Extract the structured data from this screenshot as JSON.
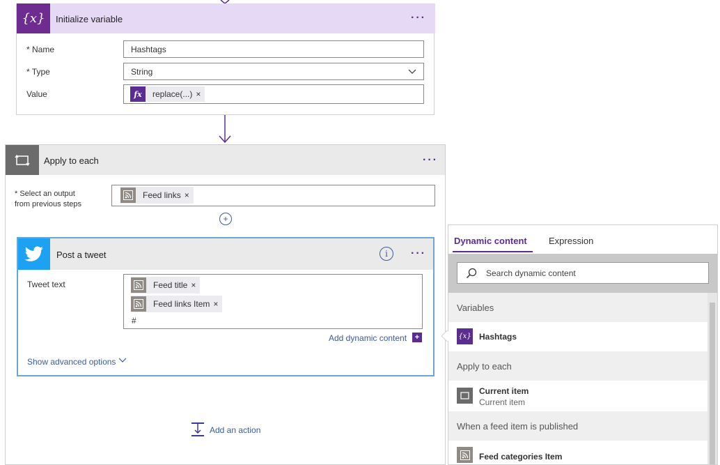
{
  "init_variable": {
    "title": "Initialize variable",
    "name_label": "* Name",
    "name_value": "Hashtags",
    "type_label": "* Type",
    "type_value": "String",
    "value_label": "Value",
    "value_token": "replace(...)",
    "token_remove": "×",
    "icon": "variable-braces-icon"
  },
  "apply_to_each": {
    "title": "Apply to each",
    "select_label_line1": "* Select an output",
    "select_label_line2": "from previous steps",
    "token": "Feed links",
    "token_remove": "×",
    "add_action_label": "Add an action",
    "icon": "loop-icon"
  },
  "post_tweet": {
    "title": "Post a tweet",
    "tweet_text_label": "Tweet text",
    "tokens": [
      "Feed title",
      "Feed links Item"
    ],
    "token_remove": "×",
    "trailing_text": "#",
    "add_dynamic_content": "Add dynamic content",
    "show_advanced": "Show advanced options",
    "icon": "twitter-bird-icon"
  },
  "dynamic_panel": {
    "tab_active": "Dynamic content",
    "tab_inactive": "Expression",
    "search_placeholder": "Search dynamic content",
    "sections": [
      {
        "header": "Variables",
        "item_title": "Hashtags",
        "item_sub": ""
      },
      {
        "header": "Apply to each",
        "item_title": "Current item",
        "item_sub": "Current item"
      },
      {
        "header": "When a feed item is published",
        "item_title": "Feed categories Item",
        "item_sub": ""
      }
    ]
  },
  "colors": {
    "accent_purple": "#5c2d91",
    "variable_header": "#e6d9f5",
    "twitter_blue": "#1da1f2",
    "tweet_border": "#6ca6d6",
    "rss_gray": "#8f8a84"
  }
}
